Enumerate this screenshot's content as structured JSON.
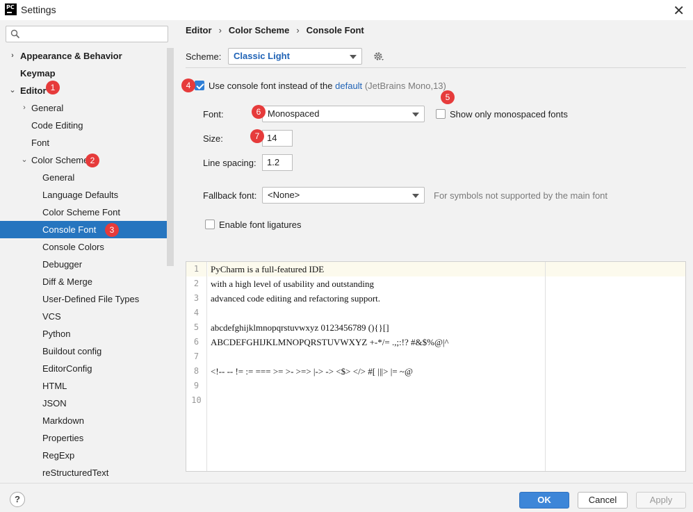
{
  "window": {
    "title": "Settings",
    "app_icon": "PC"
  },
  "sidebar": {
    "search": {
      "value": "",
      "placeholder": ""
    },
    "items": [
      {
        "label": "Appearance & Behavior",
        "arrow": "›"
      },
      {
        "label": "Keymap"
      },
      {
        "label": "Editor",
        "arrow": "⌄"
      },
      {
        "label": "General",
        "arrow": "›"
      },
      {
        "label": "Code Editing"
      },
      {
        "label": "Font"
      },
      {
        "label": "Color Scheme",
        "arrow": "⌄"
      },
      {
        "label": "General"
      },
      {
        "label": "Language Defaults"
      },
      {
        "label": "Color Scheme Font"
      },
      {
        "label": "Console Font"
      },
      {
        "label": "Console Colors"
      },
      {
        "label": "Debugger"
      },
      {
        "label": "Diff & Merge"
      },
      {
        "label": "User-Defined File Types"
      },
      {
        "label": "VCS"
      },
      {
        "label": "Python"
      },
      {
        "label": "Buildout config"
      },
      {
        "label": "EditorConfig"
      },
      {
        "label": "HTML"
      },
      {
        "label": "JSON"
      },
      {
        "label": "Markdown"
      },
      {
        "label": "Properties"
      },
      {
        "label": "RegExp"
      },
      {
        "label": "reStructuredText"
      }
    ]
  },
  "breadcrumb": {
    "part1": "Editor",
    "part2": "Color Scheme",
    "part3": "Console Font",
    "sep": "›"
  },
  "scheme": {
    "label": "Scheme:",
    "value": "Classic Light"
  },
  "console_font": {
    "use_label_prefix": "Use console font instead of the",
    "use_link": "default",
    "use_suffix": "(JetBrains Mono,13)",
    "use_checked": true,
    "font_label": "Font:",
    "font_value": "Monospaced",
    "monospaced_only_label": "Show only monospaced fonts",
    "size_label": "Size:",
    "size_value": "14",
    "line_spacing_label": "Line spacing:",
    "line_spacing_value": "1.2",
    "fallback_label": "Fallback font:",
    "fallback_value": "<None>",
    "fallback_hint": "For symbols not supported by the main font",
    "ligatures_label": "Enable font ligatures"
  },
  "badges": {
    "b1": "1",
    "b2": "2",
    "b3": "3",
    "b4": "4",
    "b5": "5",
    "b6": "6",
    "b7": "7"
  },
  "preview": {
    "line_numbers": [
      "1",
      "2",
      "3",
      "4",
      "5",
      "6",
      "7",
      "8",
      "9",
      "10"
    ],
    "lines": [
      "PyCharm is a full-featured IDE",
      "with a high level of usability and outstanding",
      "advanced code editing and refactoring support.",
      "",
      "abcdefghijklmnopqrstuvwxyz 0123456789 (){}[]",
      "ABCDEFGHIJKLMNOPQRSTUVWXYZ +-*/= .,;:!? #&$%@|^",
      "",
      "<!-- -- != := === >= >- >=> |-> -> <$> </> #[ |||> |= ~@",
      "",
      ""
    ]
  },
  "buttons": {
    "help": "?",
    "ok": "OK",
    "cancel": "Cancel",
    "apply": "Apply"
  },
  "colors": {
    "accent": "#2675bf",
    "badge": "#e63b3b",
    "link": "#2063b6"
  }
}
